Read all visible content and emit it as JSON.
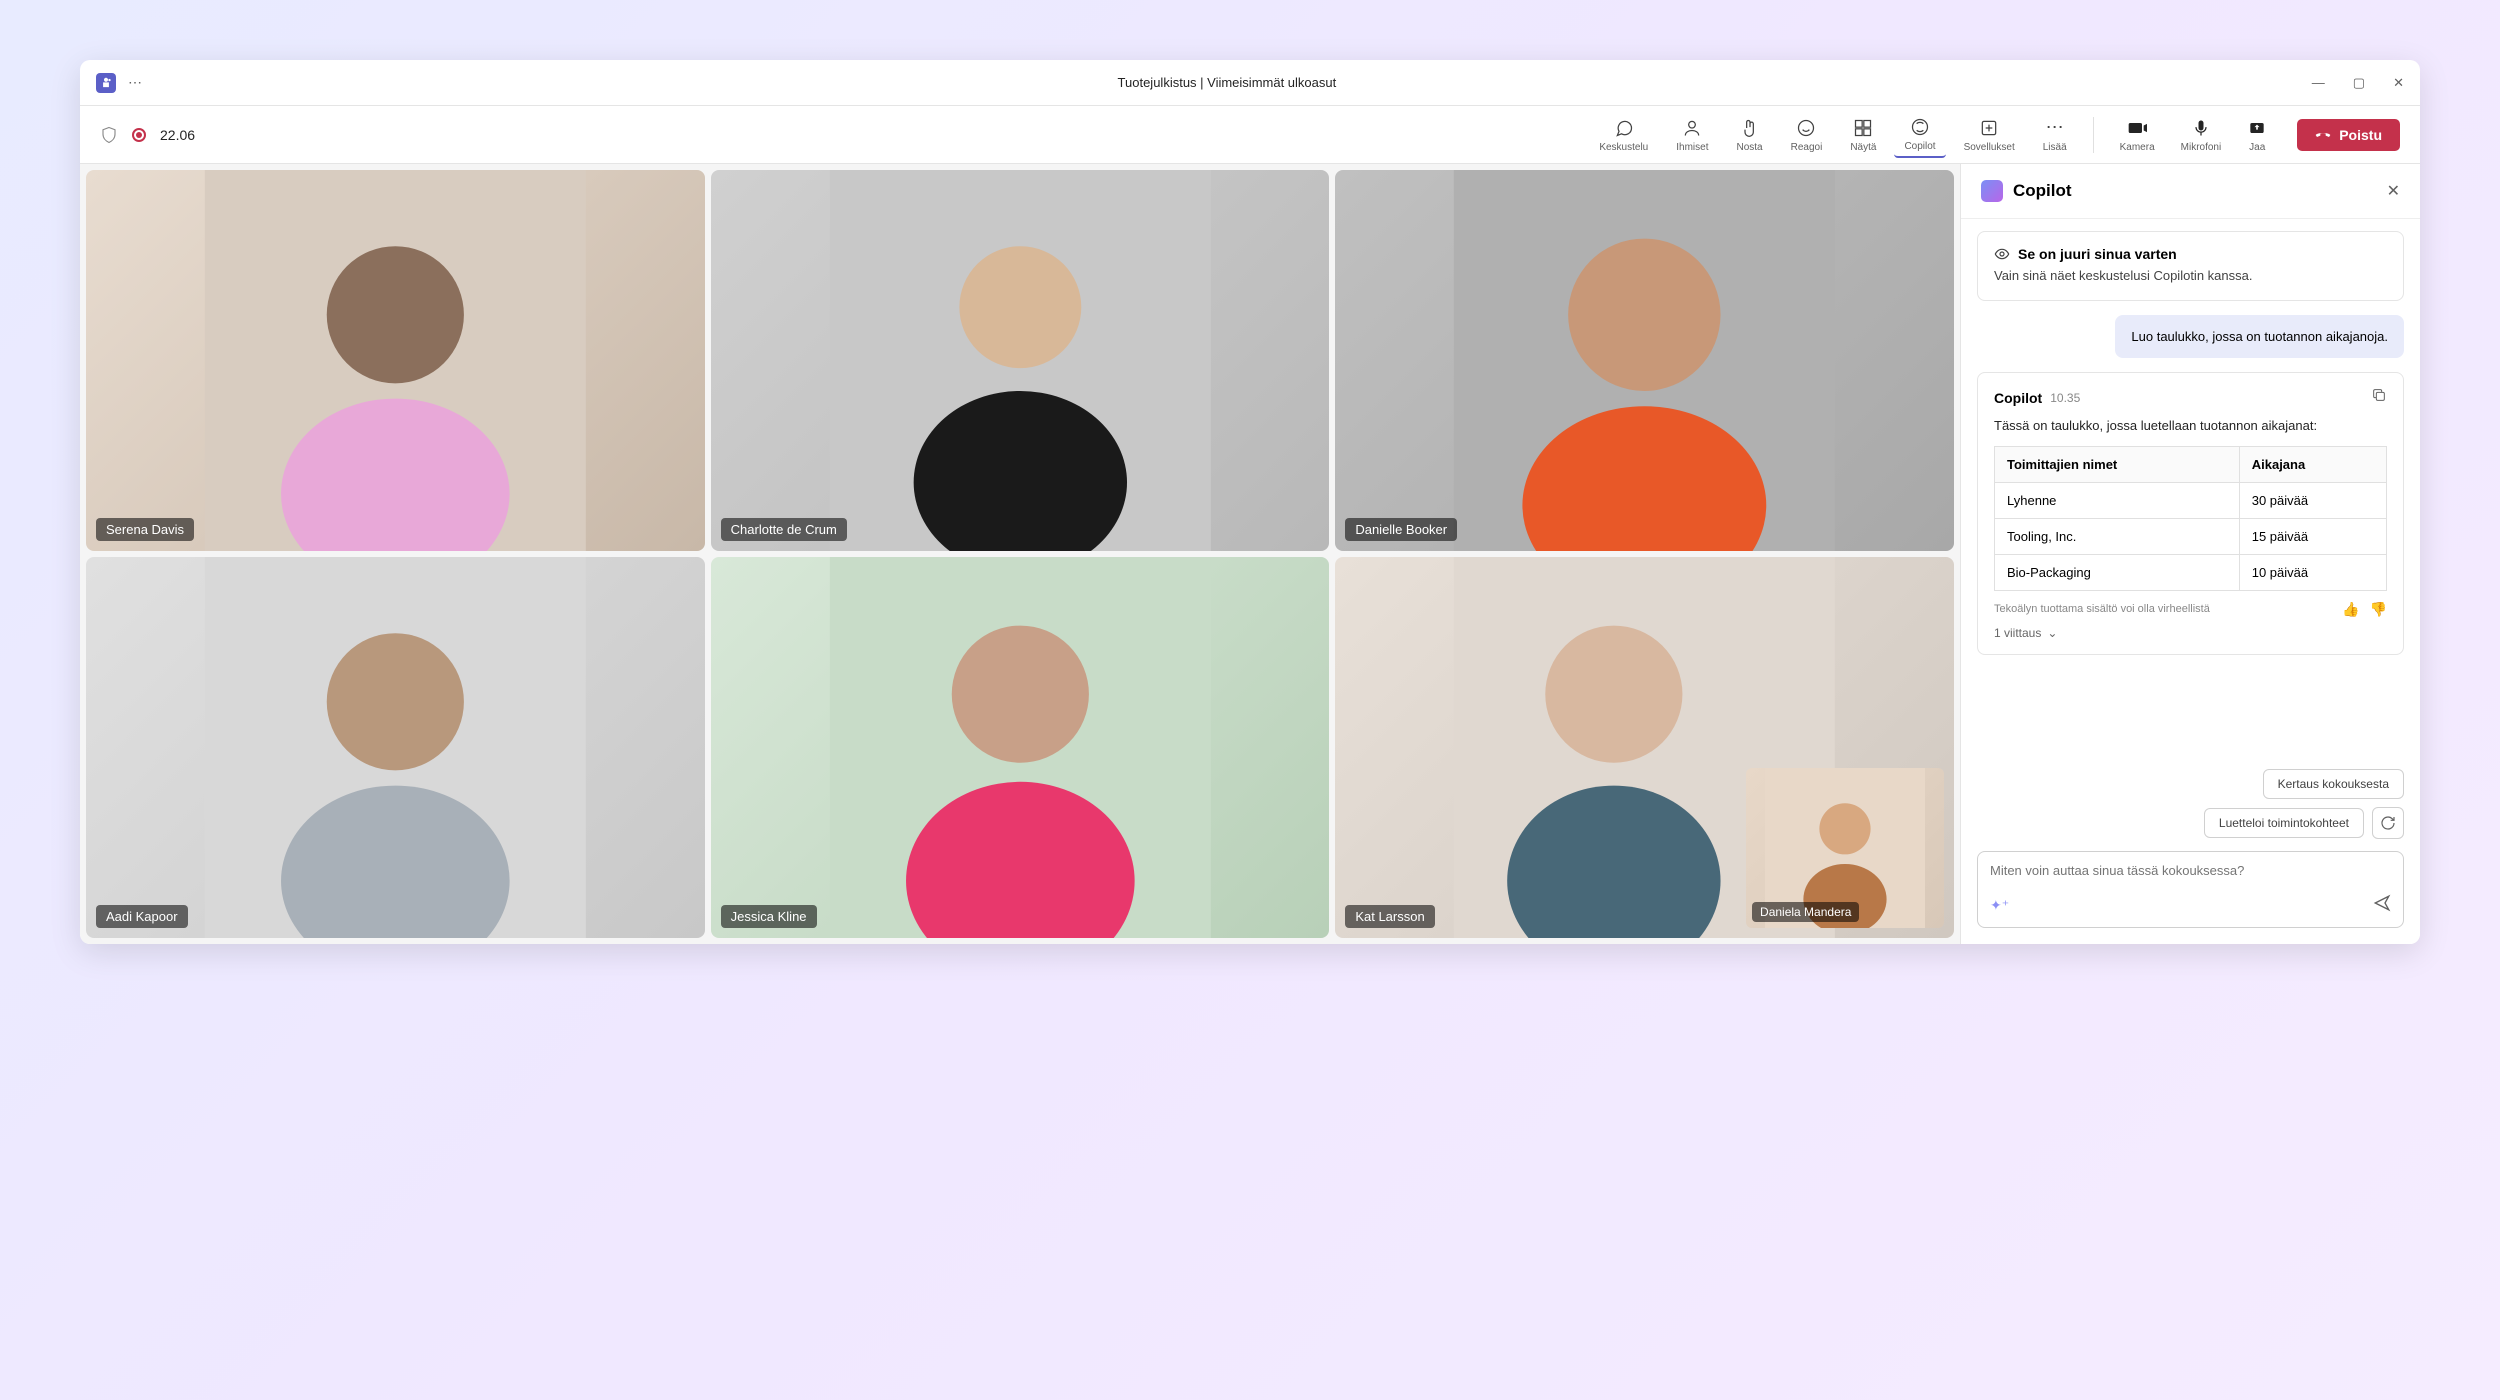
{
  "window": {
    "title": "Tuotejulkistus | Viimeisimmät ulkoasut"
  },
  "toolbar": {
    "timer": "22.06",
    "buttons": {
      "chat": "Keskustelu",
      "people": "Ihmiset",
      "raise": "Nosta",
      "react": "Reagoi",
      "view": "Näytä",
      "copilot": "Copilot",
      "apps": "Sovellukset",
      "more": "Lisää"
    },
    "controls": {
      "camera": "Kamera",
      "mic": "Mikrofoni",
      "share": "Jaa"
    },
    "leave": "Poistu"
  },
  "participants": [
    {
      "name": "Serena Davis"
    },
    {
      "name": "Charlotte de Crum"
    },
    {
      "name": "Danielle Booker"
    },
    {
      "name": "Aadi Kapoor"
    },
    {
      "name": "Jessica Kline"
    },
    {
      "name": "Kat Larsson"
    }
  ],
  "pip": {
    "name": "Daniela Mandera"
  },
  "copilot": {
    "title": "Copilot",
    "info": {
      "heading": "Se on juuri sinua varten",
      "body": "Vain sinä näet keskustelusi Copilotin kanssa."
    },
    "userPrompt": "Luo taulukko, jossa on tuotannon aikajanoja.",
    "response": {
      "name": "Copilot",
      "time": "10.35",
      "intro": "Tässä on taulukko, jossa luetellaan tuotannon aikajanat:",
      "table": {
        "headers": [
          "Toimittajien nimet",
          "Aikajana"
        ],
        "rows": [
          [
            "Lyhenne",
            "30 päivää"
          ],
          [
            "Tooling, Inc.",
            "15 päivää"
          ],
          [
            "Bio-Packaging",
            "10 päivää"
          ]
        ]
      },
      "disclaimer": "Tekoälyn tuottama sisältö voi olla virheellistä",
      "references": "1 viittaus"
    },
    "suggestions": [
      "Kertaus kokouksesta",
      "Luetteloi toimintokohteet"
    ],
    "inputPlaceholder": "Miten voin auttaa sinua tässä kokouksessa?"
  }
}
